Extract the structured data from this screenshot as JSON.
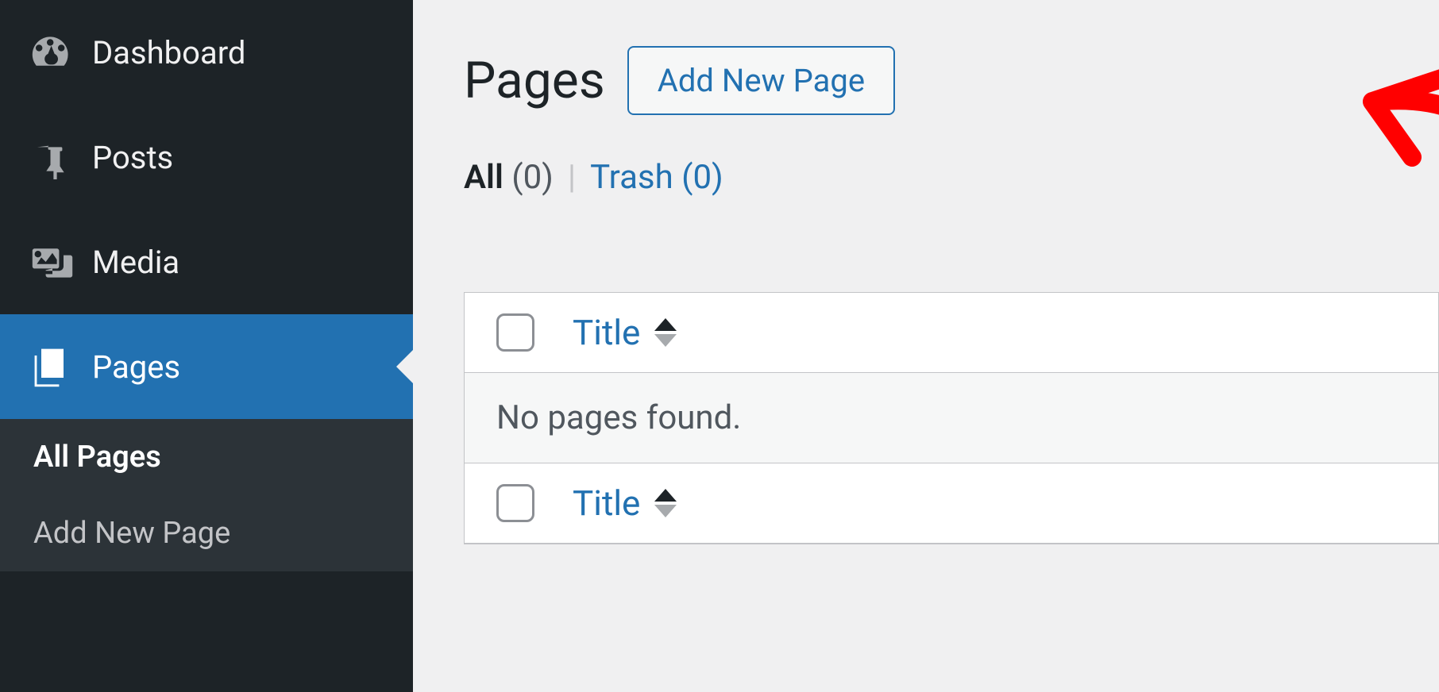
{
  "sidebar": {
    "items": [
      {
        "label": "Dashboard",
        "icon": "dashboard"
      },
      {
        "label": "Posts",
        "icon": "pin"
      },
      {
        "label": "Media",
        "icon": "media"
      },
      {
        "label": "Pages",
        "icon": "pages",
        "active": true
      }
    ],
    "sub_items": [
      {
        "label": "All Pages",
        "current": true
      },
      {
        "label": "Add New Page"
      }
    ]
  },
  "header": {
    "title": "Pages",
    "add_new_label": "Add New Page"
  },
  "filters": {
    "all_label": "All",
    "all_count": "(0)",
    "separator": "|",
    "trash_label": "Trash",
    "trash_count": "(0)"
  },
  "table": {
    "column_title": "Title",
    "empty_message": "No pages found."
  }
}
